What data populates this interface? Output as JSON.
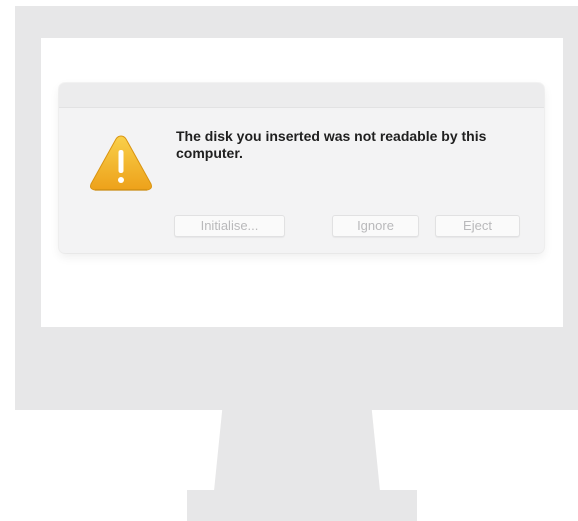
{
  "dialog": {
    "message": "The disk you inserted was not readable by this computer.",
    "icon": "warning-icon",
    "buttons": {
      "initialise": "Initialise...",
      "ignore": "Ignore",
      "eject": "Eject"
    }
  },
  "colors": {
    "monitor": "#e7e7e8",
    "warning": "#f5b82e",
    "button_text_disabled": "#b9b9bb"
  }
}
